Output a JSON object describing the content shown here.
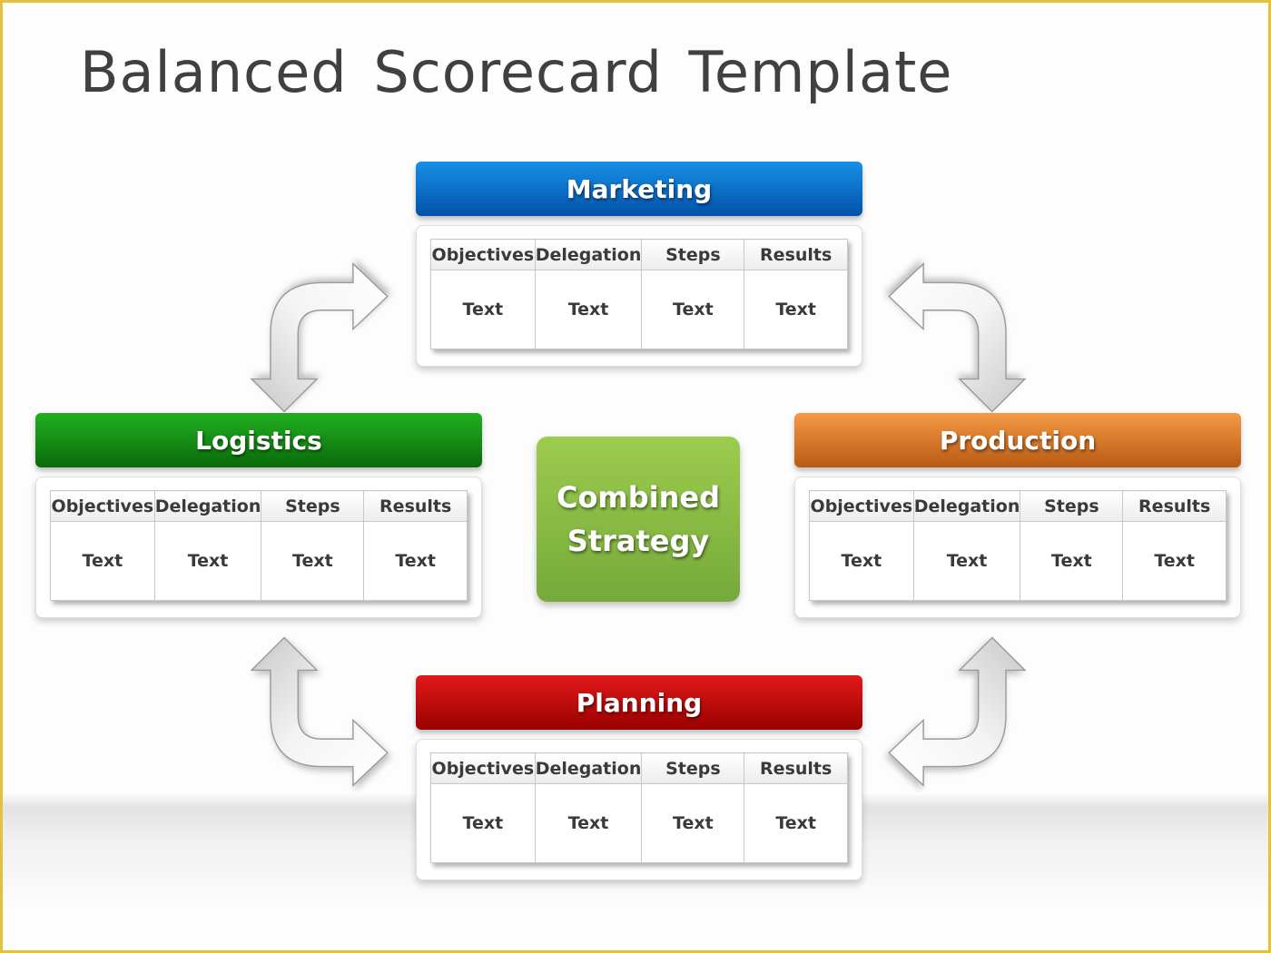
{
  "title": "Balanced Scorecard Template",
  "center": {
    "line1": "Combined",
    "line2": "Strategy",
    "color": "#8bbd45"
  },
  "panels": [
    {
      "id": "marketing",
      "title": "Marketing",
      "color_top": "#1a8ee6",
      "color_bottom": "#0053a8",
      "columns": [
        "Objectives",
        "Delegation",
        "Steps",
        "Results"
      ],
      "cells": [
        "Text",
        "Text",
        "Text",
        "Text"
      ]
    },
    {
      "id": "logistics",
      "title": "Logistics",
      "color_top": "#22b022",
      "color_bottom": "#0a6a0a",
      "columns": [
        "Objectives",
        "Delegation",
        "Steps",
        "Results"
      ],
      "cells": [
        "Text",
        "Text",
        "Text",
        "Text"
      ]
    },
    {
      "id": "production",
      "title": "Production",
      "color_top": "#f59a45",
      "color_bottom": "#b85a12",
      "columns": [
        "Objectives",
        "Delegation",
        "Steps",
        "Results"
      ],
      "cells": [
        "Text",
        "Text",
        "Text",
        "Text"
      ]
    },
    {
      "id": "planning",
      "title": "Planning",
      "color_top": "#e21a1a",
      "color_bottom": "#9a0000",
      "columns": [
        "Objectives",
        "Delegation",
        "Steps",
        "Results"
      ],
      "cells": [
        "Text",
        "Text",
        "Text",
        "Text"
      ]
    }
  ],
  "arrows": [
    {
      "name": "curved-arrow-logistics-marketing-icon",
      "direction": "right and down"
    },
    {
      "name": "curved-arrow-marketing-production-icon",
      "direction": "left and down"
    },
    {
      "name": "curved-arrow-logistics-planning-icon",
      "direction": "up and right"
    },
    {
      "name": "curved-arrow-planning-production-icon",
      "direction": "up and left"
    }
  ]
}
